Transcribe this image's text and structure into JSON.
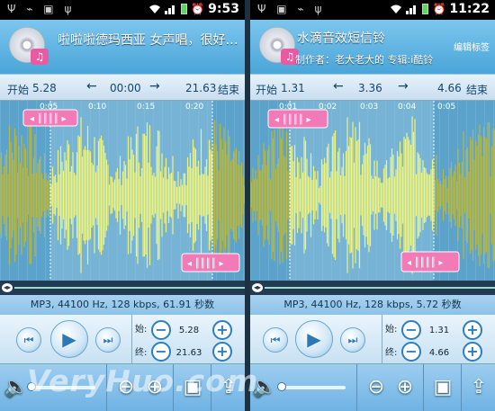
{
  "watermark": "VeryHuo.com",
  "left": {
    "status": {
      "time": "9:53",
      "icons": "Ψ ⌁ ▣ ψ"
    },
    "title": "啦啦啦德玛西亚 女声唱，很好…",
    "meta": "",
    "edit": "",
    "start_label": "开始",
    "start_value": "5.28",
    "current_time": "00:00",
    "end_value": "21.63",
    "end_label": "结束",
    "ruler": [
      "0:05",
      "0:10",
      "0:15",
      "0:20"
    ],
    "file_info": "MP3, 44100 Hz, 128 kbps, 61.91 秒数",
    "start_short": "始:",
    "end_short": "终:",
    "start_num": "5.28",
    "end_num": "21.63"
  },
  "right": {
    "status": {
      "time": "11:22",
      "icons": "Ψ ▣ ⌁ ψ"
    },
    "title": "水滴音效短信铃",
    "meta": "制作者：老大老大的  专辑:i酷铃",
    "edit": "编辑标签",
    "start_label": "开始",
    "start_value": "1.31",
    "current_time": "3.36",
    "end_value": "4.66",
    "end_label": "结束",
    "ruler": [
      "0:01",
      "0:02",
      "0:03",
      "0:04",
      "0:05"
    ],
    "file_info": "MP3, 44100 Hz, 128 kbps, 5.72 秒数",
    "start_short": "始:",
    "end_short": "终:",
    "start_num": "1.31",
    "end_num": "4.66"
  },
  "colors": {
    "accent": "#4aa5d8",
    "wave_active": "#f4f778",
    "wave_inactive": "#c5bb2b",
    "marker": "#f27ab6",
    "dark": "#1c3142"
  },
  "icons": [
    "rewind-icon",
    "play-icon",
    "fast-forward-icon",
    "minus-icon",
    "plus-icon",
    "volume-icon",
    "zoom-out-icon",
    "zoom-in-icon",
    "save-icon",
    "upload-icon"
  ]
}
